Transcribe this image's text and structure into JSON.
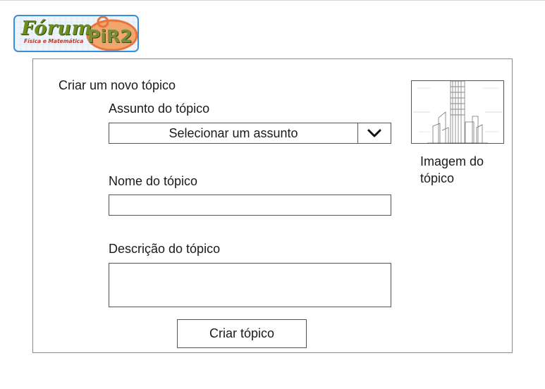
{
  "logo": {
    "word": "Fórum",
    "subtitle": "Física e Matemática",
    "brand": "PiR2"
  },
  "form": {
    "heading": "Criar um novo tópico",
    "subject": {
      "label": "Assunto do tópico",
      "selected": "Selecionar um assunto",
      "icon": "chevron-down-icon"
    },
    "name": {
      "label": "Nome do tópico",
      "value": ""
    },
    "description": {
      "label": "Descrição do tópico",
      "value": ""
    },
    "submit_label": "Criar tópico"
  },
  "image": {
    "label": "Imagem do tópico"
  },
  "colors": {
    "logo_border": "#3a8fd8",
    "logo_text": "#6b8f1f",
    "logo_accent": "#e8743b"
  }
}
